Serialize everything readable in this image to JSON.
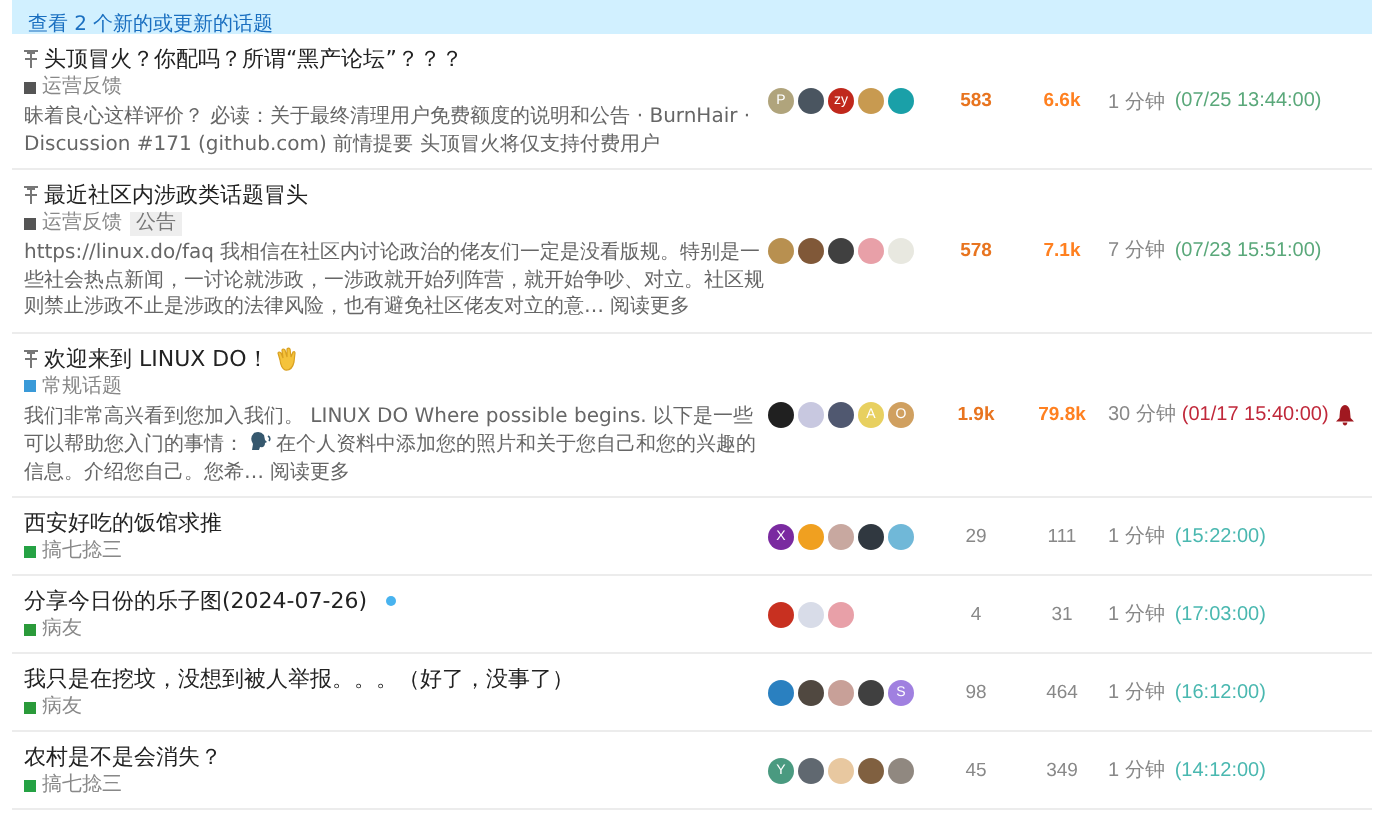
{
  "banner": {
    "text": "查看 2 个新的或更新的话题"
  },
  "topics": [
    {
      "pinned": true,
      "title": "头顶冒火？你配吗？所谓“黑产论坛”？？？",
      "category": {
        "name": "运营反馈",
        "color": "#555555"
      },
      "excerpt": [
        "昧着良心这样评价？ 必读：关于最终清理用户免费额度的说明和公告 · BurnHair · Discussion #171 (github.com) 前情提要 头顶冒火将仅支持付费用户"
      ],
      "posters": [
        {
          "letter": "P",
          "color": "#b0a47c"
        },
        {
          "color": "#4a5560"
        },
        {
          "letter": "zy",
          "color": "#c0281c"
        },
        {
          "color": "#c89a50"
        },
        {
          "color": "#1aa0a8"
        }
      ],
      "replies": "583",
      "views": "6.6k",
      "hot": true,
      "activity": {
        "age": "1 分钟",
        "date": "(07/25 13:44:00)",
        "color": "#5aa87a"
      }
    },
    {
      "pinned": true,
      "title": "最近社区内涉政类话题冒头",
      "category": {
        "name": "运营反馈",
        "color": "#555555"
      },
      "tags": [
        "公告"
      ],
      "excerpt": [
        "https://linux.do/faq 我相信在社区内讨论政治的佬友们一定是没看版规。特别是一些社会热点新闻，一讨论就涉政，一涉政就开始列阵营，就开始争吵、对立。社区规则禁止涉政不止是涉政的法律风险，也有避免社区佬友对立的意… "
      ],
      "read_more": "阅读更多",
      "posters": [
        {
          "color": "#b89050"
        },
        {
          "color": "#805838"
        },
        {
          "color": "#404040"
        },
        {
          "color": "#e8a0a8"
        },
        {
          "color": "#e8e8e0"
        }
      ],
      "replies": "578",
      "views": "7.1k",
      "hot": true,
      "activity": {
        "age": "7 分钟",
        "date": "(07/23 15:51:00)",
        "color": "#5aa87a"
      }
    },
    {
      "pinned": true,
      "title": "欢迎来到 LINUX DO！",
      "wave": true,
      "category": {
        "name": "常规话题",
        "color": "#3a9ad8"
      },
      "excerpt": [
        "我们非常高兴看到您加入我们。 LINUX DO Where possible begins. 以下是一些可以帮助您入门的事情：",
        "在个人资料中添加您的照片和关于您自己和您的兴趣的信息。介绍您自己。您希… "
      ],
      "read_more": "阅读更多",
      "posters": [
        {
          "color": "#202020"
        },
        {
          "color": "#c8c8e0"
        },
        {
          "color": "#505870"
        },
        {
          "letter": "A",
          "color": "#e8d060"
        },
        {
          "letter": "O",
          "color": "#d0a060"
        }
      ],
      "replies": "1.9k",
      "views": "79.8k",
      "hot": true,
      "activity": {
        "age": "30 分钟",
        "date": "(01/17 15:40:00)",
        "color": "#c0283a",
        "bell": true
      }
    },
    {
      "title": "西安好吃的饭馆求推",
      "category": {
        "name": "搞七捻三",
        "color": "#25a244"
      },
      "posters": [
        {
          "letter": "X",
          "color": "#7a2aa0"
        },
        {
          "color": "#f0a020"
        },
        {
          "color": "#c8a8a0"
        },
        {
          "color": "#303840"
        },
        {
          "color": "#70b8d8"
        }
      ],
      "replies": "29",
      "views": "111",
      "hot": false,
      "activity": {
        "age": "1 分钟",
        "date": "(15:22:00)",
        "color": "#4ab8b0"
      }
    },
    {
      "unread": true,
      "title": "分享今日份的乐子图(2024-07-26)",
      "category": {
        "name": "病友",
        "color": "#2a9a3a"
      },
      "posters": [
        {
          "color": "#c83020"
        },
        {
          "color": "#d8dce8"
        },
        {
          "color": "#e8a0a8"
        }
      ],
      "replies": "4",
      "views": "31",
      "hot": false,
      "activity": {
        "age": "1 分钟",
        "date": "(17:03:00)",
        "color": "#4ab8b0"
      }
    },
    {
      "title": "我只是在挖坟，没想到被人举报。。。（好了，没事了）",
      "category": {
        "name": "病友",
        "color": "#2a9a3a"
      },
      "posters": [
        {
          "color": "#2a80c0"
        },
        {
          "color": "#504840"
        },
        {
          "color": "#c8a098"
        },
        {
          "color": "#404040"
        },
        {
          "letter": "S",
          "color": "#a080e0"
        }
      ],
      "replies": "98",
      "views": "464",
      "hot": false,
      "activity": {
        "age": "1 分钟",
        "date": "(16:12:00)",
        "color": "#4ab8b0"
      }
    },
    {
      "title": "农村是不是会消失？",
      "category": {
        "name": "搞七捻三",
        "color": "#25a244"
      },
      "posters": [
        {
          "letter": "Y",
          "color": "#4a9a80"
        },
        {
          "color": "#606870"
        },
        {
          "color": "#e8c8a0"
        },
        {
          "color": "#806040"
        },
        {
          "color": "#908880"
        }
      ],
      "replies": "45",
      "views": "349",
      "hot": false,
      "activity": {
        "age": "1 分钟",
        "date": "(14:12:00)",
        "color": "#4ab8b0"
      }
    }
  ]
}
